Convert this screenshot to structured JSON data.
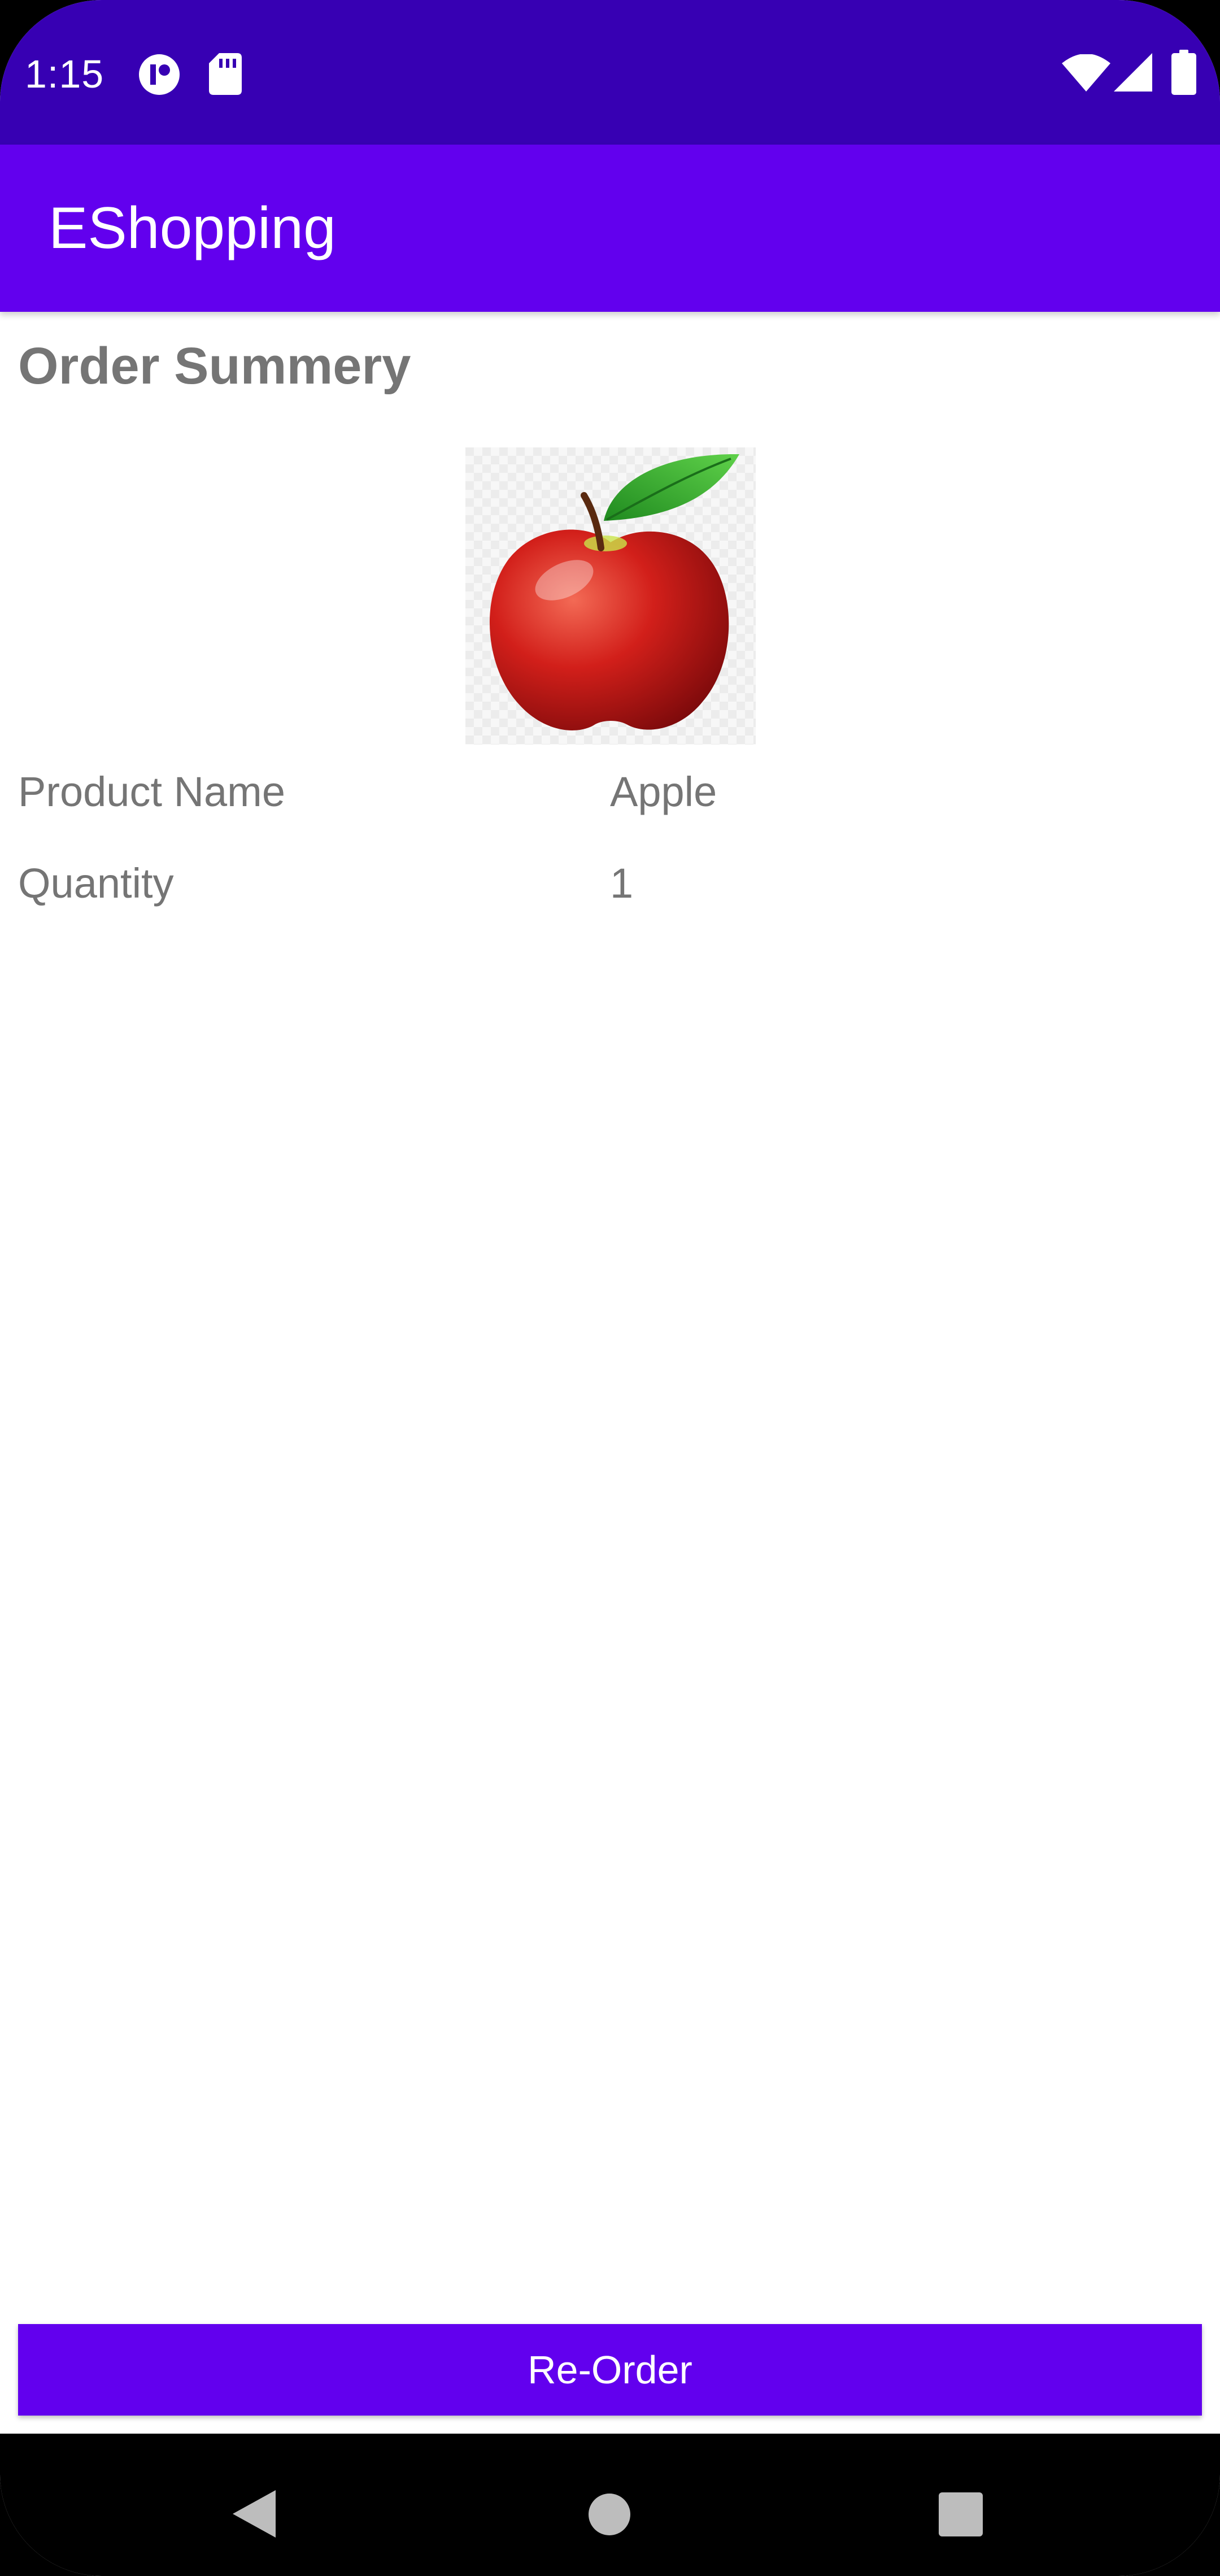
{
  "status_bar": {
    "time": "1:15",
    "icons": [
      "record-icon",
      "sd-card-icon",
      "wifi-icon",
      "cell-signal-icon",
      "battery-icon"
    ]
  },
  "app_bar": {
    "title": "EShopping"
  },
  "order": {
    "heading": "Order Summery",
    "product_image": "apple-image",
    "rows": [
      {
        "label": "Product Name",
        "value": "Apple"
      },
      {
        "label": "Quantity",
        "value": "1"
      }
    ]
  },
  "actions": {
    "reorder_label": "Re-Order"
  },
  "nav_bar": {
    "buttons": [
      "back-icon",
      "home-icon",
      "recents-icon"
    ]
  },
  "colors": {
    "status_bar": "#3700b3",
    "primary": "#6200ee",
    "text_secondary": "#757575"
  }
}
